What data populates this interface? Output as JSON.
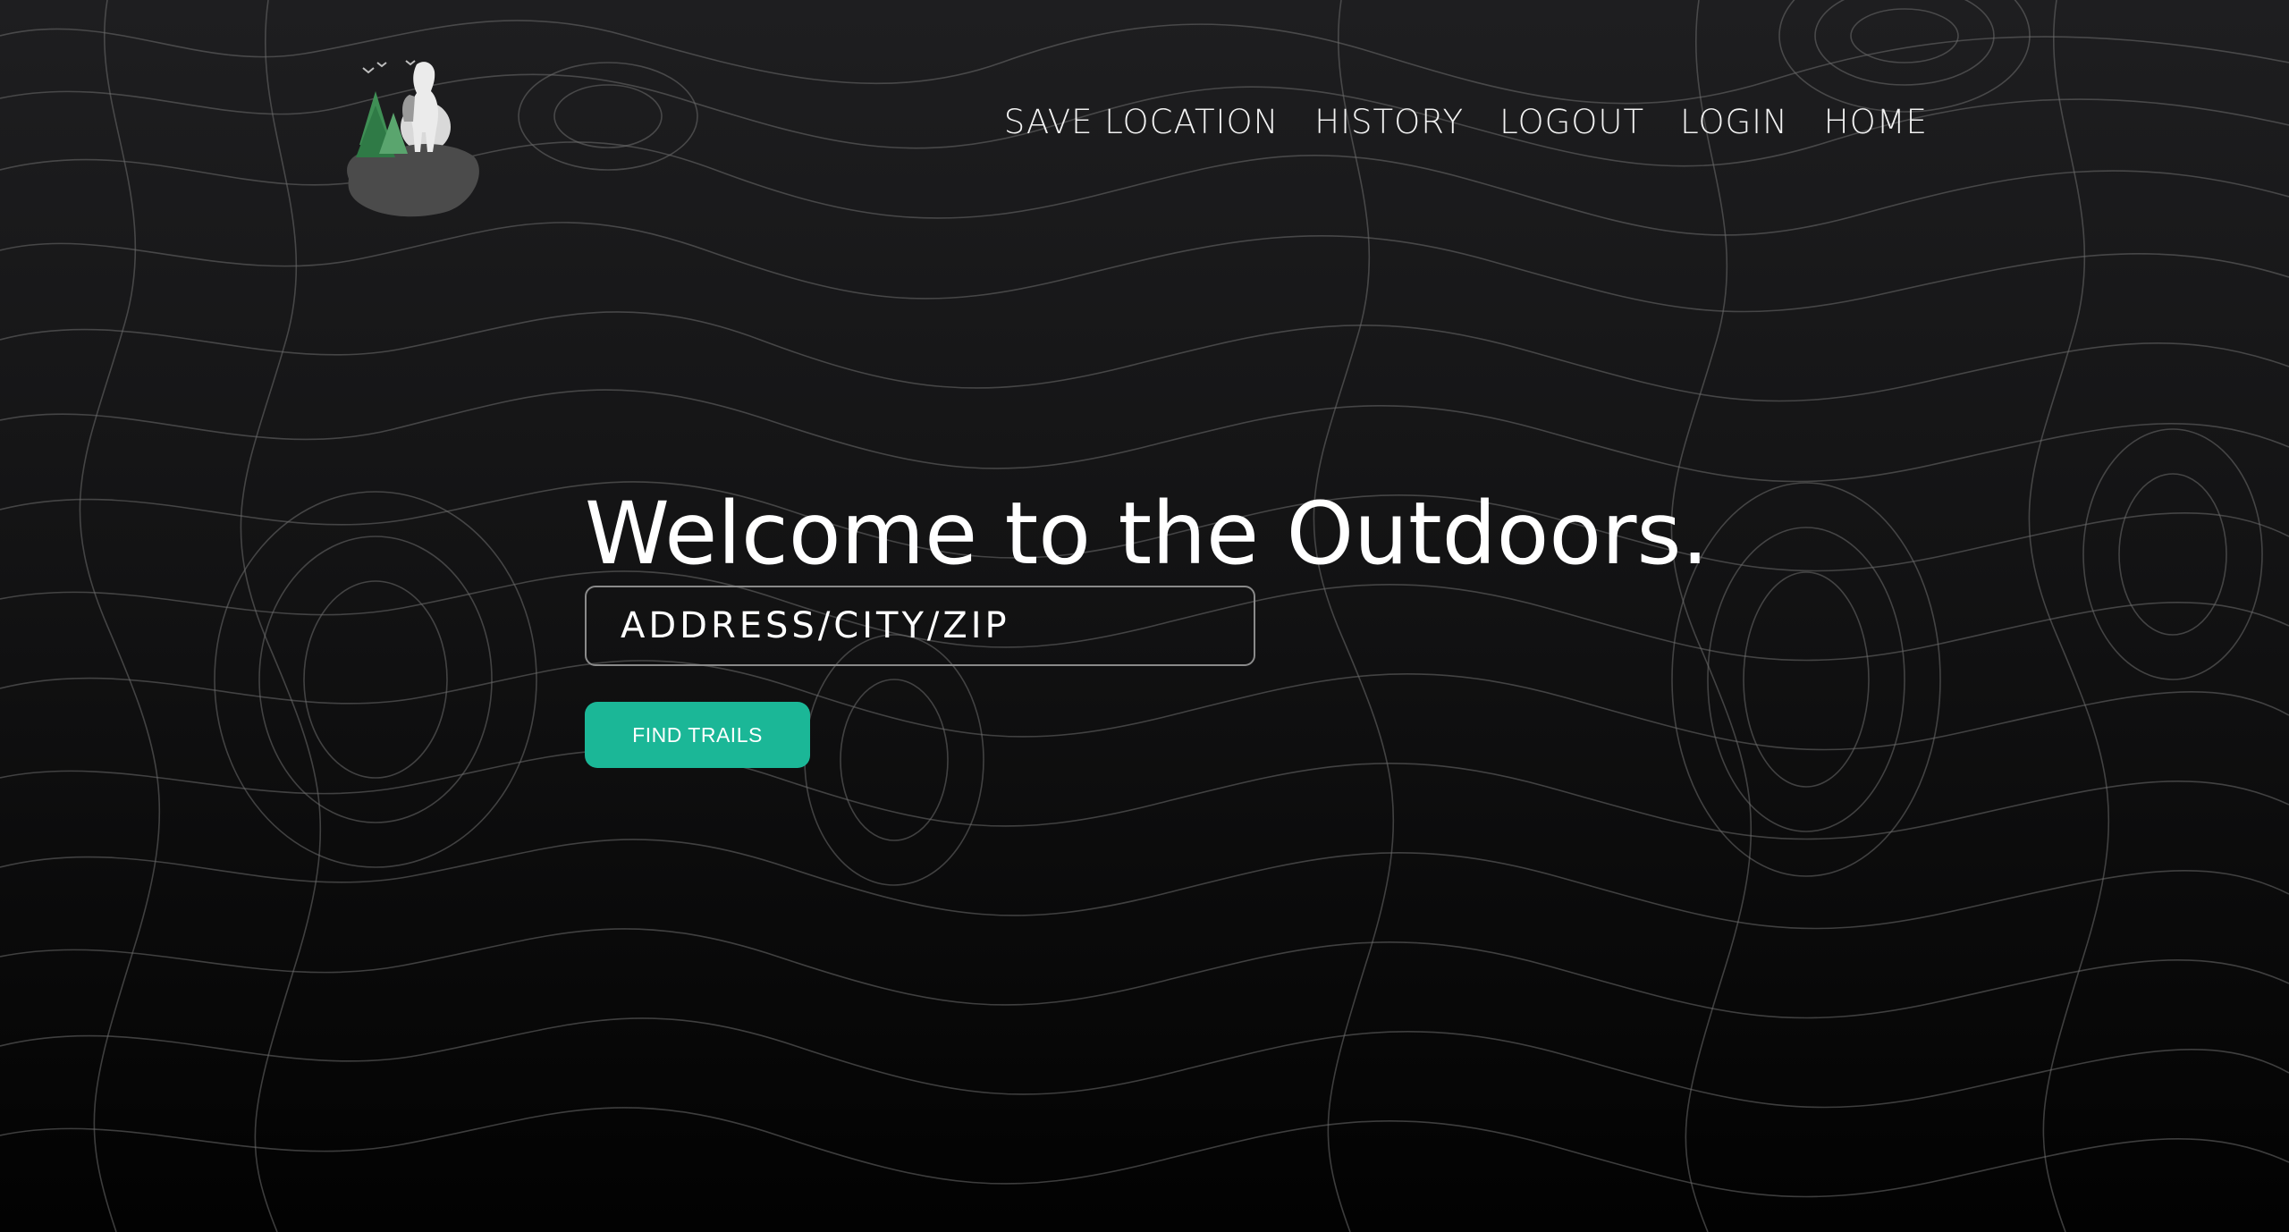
{
  "nav": {
    "items": [
      {
        "label": "SAVE LOCATION"
      },
      {
        "label": "HISTORY"
      },
      {
        "label": "LOGOUT"
      },
      {
        "label": "LOGIN"
      },
      {
        "label": "HOME"
      }
    ]
  },
  "hero": {
    "title": "Welcome to the Outdoors.",
    "search_placeholder": "ADDRESS/CITY/ZIP",
    "search_value": "",
    "button_label": "FIND TRAILS"
  },
  "colors": {
    "accent": "#1bb797",
    "background_top": "#1e1e20",
    "background_bottom": "#020202",
    "text": "#ffffff",
    "topo_lines": "#6e6e6e"
  },
  "icons": {
    "logo": "hiker-on-rock-logo-icon"
  }
}
